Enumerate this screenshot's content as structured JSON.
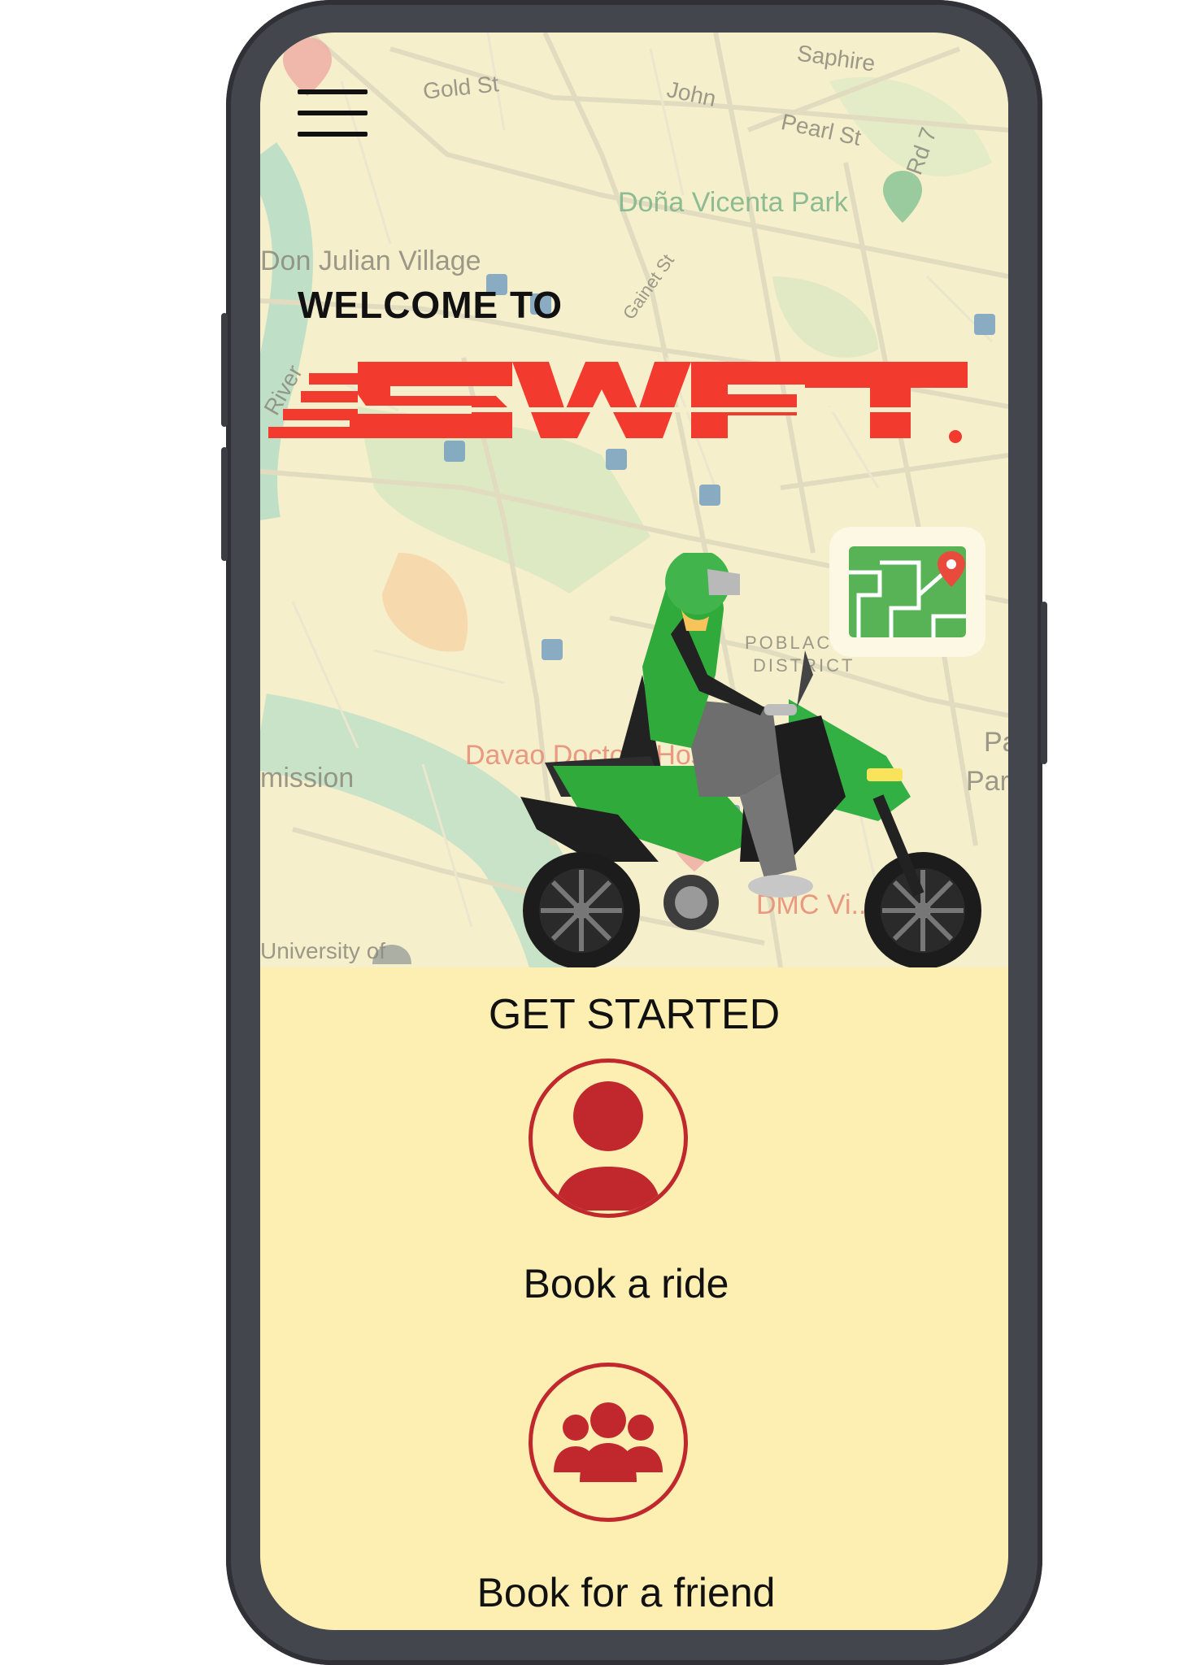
{
  "app": {
    "brand": "SWFT",
    "brand_color": "#f23a2f",
    "accent": "#c0282e",
    "map_bg": "#f6efcc",
    "panel_bg": "#fdeeb2"
  },
  "header": {
    "menu_icon": "hamburger-icon",
    "welcome": "WELCOME TO"
  },
  "map": {
    "labels": [
      "Gold St",
      "John",
      "Saphire",
      "Pearl St",
      "Rd 7",
      "Doña Vicenta Park",
      "Don Julian Village",
      "Gainet St",
      "River",
      "POBLACION",
      "DISTRICT",
      "Davao Doctors Hospital",
      "mission",
      "Pa",
      "Par",
      "University of",
      "DMC Vi...ures"
    ]
  },
  "main": {
    "title": "GET STARTED",
    "actions": [
      {
        "label": "Book a ride",
        "icon": "person-icon"
      },
      {
        "label": "Book for a friend",
        "icon": "group-icon"
      }
    ]
  }
}
